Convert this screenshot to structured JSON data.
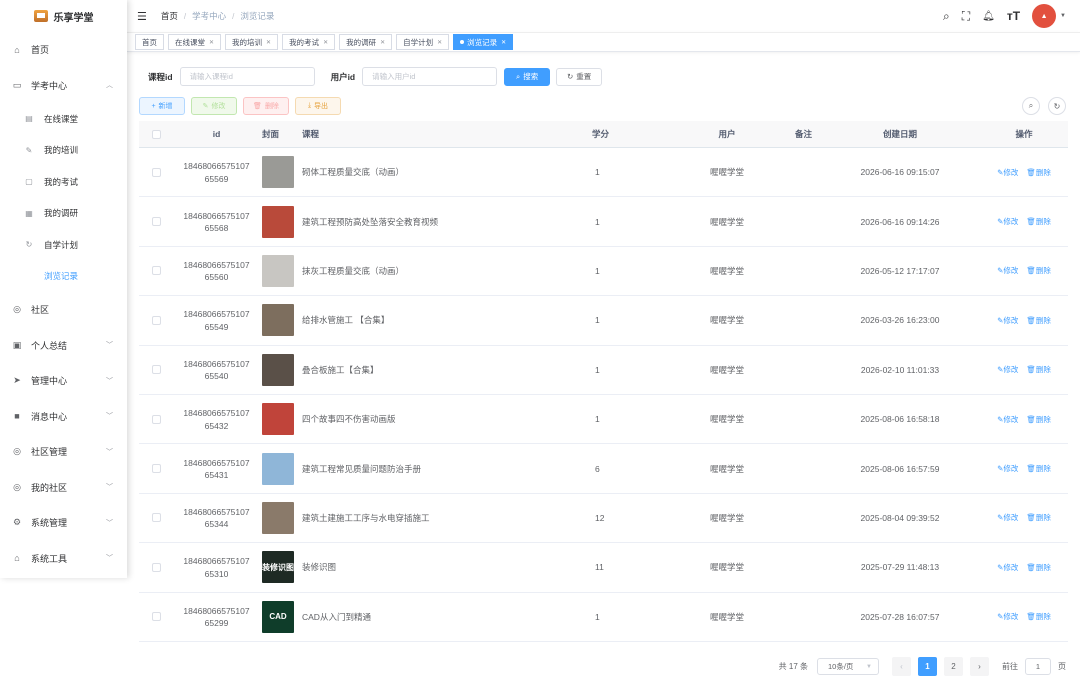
{
  "app": {
    "name": "乐享学堂"
  },
  "sidebar": {
    "items": [
      {
        "label": "首页",
        "icon": "dashboard-icon",
        "glyph": "⌂",
        "chevron": ""
      },
      {
        "label": "学考中心",
        "icon": "monitor-icon",
        "glyph": "▭",
        "chevron": "︿"
      }
    ],
    "subitems": [
      {
        "label": "在线课堂",
        "icon": "file-icon",
        "glyph": "▤"
      },
      {
        "label": "我的培训",
        "icon": "edit-icon",
        "glyph": "✎"
      },
      {
        "label": "我的考试",
        "icon": "document-icon",
        "glyph": "▢"
      },
      {
        "label": "我的调研",
        "icon": "chart-icon",
        "glyph": "▦"
      },
      {
        "label": "自学计划",
        "icon": "refresh-icon",
        "glyph": "↻"
      },
      {
        "label": "浏览记录",
        "icon": "",
        "glyph": ""
      }
    ],
    "items2": [
      {
        "label": "社区",
        "icon": "globe-icon",
        "glyph": "◎",
        "chevron": ""
      },
      {
        "label": "个人总结",
        "icon": "note-icon",
        "glyph": "▣",
        "chevron": "﹀"
      },
      {
        "label": "管理中心",
        "icon": "send-icon",
        "glyph": "➤",
        "chevron": "﹀"
      },
      {
        "label": "消息中心",
        "icon": "message-icon",
        "glyph": "■",
        "chevron": "﹀"
      },
      {
        "label": "社区管理",
        "icon": "globe-icon",
        "glyph": "◎",
        "chevron": "﹀"
      },
      {
        "label": "我的社区",
        "icon": "globe-icon",
        "glyph": "◎",
        "chevron": "﹀"
      },
      {
        "label": "系统管理",
        "icon": "settings-icon",
        "glyph": "⚙",
        "chevron": "﹀"
      },
      {
        "label": "系统工具",
        "icon": "tool-icon",
        "glyph": "⌂",
        "chevron": "﹀"
      }
    ]
  },
  "breadcrumb": {
    "home": "首页",
    "section": "学考中心",
    "current": "浏览记录"
  },
  "tags": [
    {
      "label": "首页",
      "closable": false,
      "active": false
    },
    {
      "label": "在线课堂",
      "closable": true,
      "active": false
    },
    {
      "label": "我的培训",
      "closable": true,
      "active": false
    },
    {
      "label": "我的考试",
      "closable": true,
      "active": false
    },
    {
      "label": "我的调研",
      "closable": true,
      "active": false
    },
    {
      "label": "自学计划",
      "closable": true,
      "active": false
    },
    {
      "label": "浏览记录",
      "closable": true,
      "active": true
    }
  ],
  "search": {
    "course_label": "课程id",
    "course_placeholder": "请输入课程id",
    "user_label": "用户id",
    "user_placeholder": "请输入用户id",
    "search_button": "搜索",
    "reset_button": "重置"
  },
  "actions": {
    "add": "新增",
    "edit": "修改",
    "delete": "删除",
    "export": "导出"
  },
  "table": {
    "columns": {
      "id": "id",
      "cover": "封面",
      "course": "课程",
      "credit": "学分",
      "user": "用户",
      "note": "备注",
      "date": "创建日期",
      "ops": "操作"
    },
    "op_edit": "修改",
    "op_delete": "删除",
    "rows": [
      {
        "id1": "18468066575107",
        "id2": "65569",
        "course": "砌体工程质量交底（动画）",
        "credit": "1",
        "user": "喔喔学堂",
        "note": "",
        "date": "2026-06-16 09:15:07",
        "cover_text": "",
        "cover_bg": "#9a9a96"
      },
      {
        "id1": "18468066575107",
        "id2": "65568",
        "course": "建筑工程预防高处坠落安全教育视频",
        "credit": "1",
        "user": "喔喔学堂",
        "note": "",
        "date": "2026-06-16 09:14:26",
        "cover_text": "",
        "cover_bg": "#b94a3a"
      },
      {
        "id1": "18468066575107",
        "id2": "65560",
        "course": "抹灰工程质量交底（动画）",
        "credit": "1",
        "user": "喔喔学堂",
        "note": "",
        "date": "2026-05-12 17:17:07",
        "cover_text": "",
        "cover_bg": "#c8c6c2"
      },
      {
        "id1": "18468066575107",
        "id2": "65549",
        "course": "给排水管施工 【合集】",
        "credit": "1",
        "user": "喔喔学堂",
        "note": "",
        "date": "2026-03-26 16:23:00",
        "cover_text": "",
        "cover_bg": "#7d6e5e"
      },
      {
        "id1": "18468066575107",
        "id2": "65540",
        "course": "叠合板施工【合集】",
        "credit": "1",
        "user": "喔喔学堂",
        "note": "",
        "date": "2026-02-10 11:01:33",
        "cover_text": "",
        "cover_bg": "#5a5048"
      },
      {
        "id1": "18468066575107",
        "id2": "65432",
        "course": "四个故事四不伤害动画版",
        "credit": "1",
        "user": "喔喔学堂",
        "note": "",
        "date": "2025-08-06 16:58:18",
        "cover_text": "",
        "cover_bg": "#c0443a"
      },
      {
        "id1": "18468066575107",
        "id2": "65431",
        "course": "建筑工程常见质量问题防治手册",
        "credit": "6",
        "user": "喔喔学堂",
        "note": "",
        "date": "2025-08-06 16:57:59",
        "cover_text": "",
        "cover_bg": "#8fb6d8"
      },
      {
        "id1": "18468066575107",
        "id2": "65344",
        "course": "建筑土建施工工序与水电穿插施工",
        "credit": "12",
        "user": "喔喔学堂",
        "note": "",
        "date": "2025-08-04 09:39:52",
        "cover_text": "",
        "cover_bg": "#8a7a6a"
      },
      {
        "id1": "18468066575107",
        "id2": "65310",
        "course": "装修识图",
        "credit": "11",
        "user": "喔喔学堂",
        "note": "",
        "date": "2025-07-29 11:48:13",
        "cover_text": "装修识图",
        "cover_bg": "#1e2a24"
      },
      {
        "id1": "18468066575107",
        "id2": "65299",
        "course": "CAD从入门到精通",
        "credit": "1",
        "user": "喔喔学堂",
        "note": "",
        "date": "2025-07-28 16:07:57",
        "cover_text": "CAD",
        "cover_bg": "#0f3d2a"
      }
    ]
  },
  "pagination": {
    "total": "共 17 条",
    "page_size": "10条/页",
    "pages": [
      "1",
      "2"
    ],
    "current_page": "1",
    "goto": "前往",
    "goto_value": "1",
    "page_unit": "页"
  },
  "colors": {
    "primary": "#409eff",
    "avatar": "#e2503e"
  }
}
